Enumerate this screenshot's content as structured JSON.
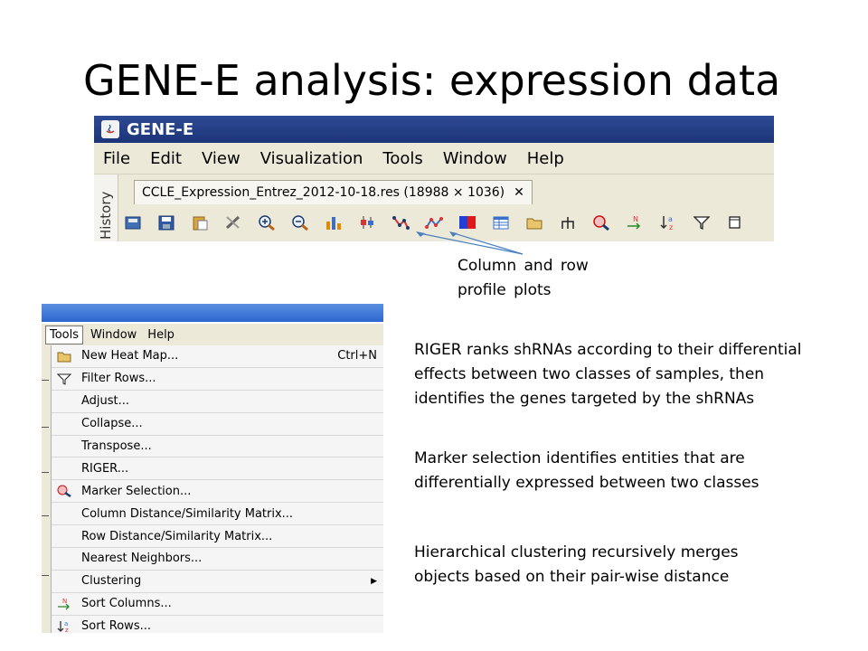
{
  "slide": {
    "title": "GENE-E analysis: expression data"
  },
  "app": {
    "title": "GENE-E",
    "menu": [
      "File",
      "Edit",
      "View",
      "Visualization",
      "Tools",
      "Window",
      "Help"
    ],
    "history_label": "History",
    "tab": {
      "label": "CCLE_Expression_Entrez_2012-10-18.res (18988 × 1036)",
      "close": "✕"
    },
    "toolbar_icons": [
      "open-icon",
      "save-icon",
      "paste-icon",
      "tools-icon",
      "zoom-in-icon",
      "zoom-out-icon",
      "bar-chart-icon",
      "box-plot-icon",
      "column-profile-plot-icon",
      "row-profile-plot-icon",
      "heatmap-color-icon",
      "table-icon",
      "folder-icon",
      "tree-icon",
      "marker-selection-icon",
      "sort-columns-icon",
      "sort-rows-icon",
      "filter-icon",
      "window-icon"
    ]
  },
  "annotation": {
    "line1": "Column and row",
    "line2": "profile plots"
  },
  "tools_menu": {
    "menubar": [
      "Tools",
      "Window",
      "Help"
    ],
    "items": [
      {
        "label": "New Heat Map...",
        "shortcut": "Ctrl+N",
        "icon": "folder-icon"
      },
      {
        "label": "Filter Rows...",
        "shortcut": "",
        "icon": "filter-icon"
      },
      {
        "label": "Adjust...",
        "shortcut": "",
        "icon": ""
      },
      {
        "label": "Collapse...",
        "shortcut": "",
        "icon": ""
      },
      {
        "label": "Transpose...",
        "shortcut": "",
        "icon": ""
      },
      {
        "label": "RIGER...",
        "shortcut": "",
        "icon": ""
      },
      {
        "label": "Marker Selection...",
        "shortcut": "",
        "icon": "marker-selection-icon"
      },
      {
        "label": "Column Distance/Similarity Matrix...",
        "shortcut": "",
        "icon": ""
      },
      {
        "label": "Row Distance/Similarity Matrix...",
        "shortcut": "",
        "icon": ""
      },
      {
        "label": "Nearest Neighbors...",
        "shortcut": "",
        "icon": ""
      },
      {
        "label": "Clustering",
        "shortcut": "",
        "icon": "",
        "submenu": true
      },
      {
        "label": "Sort Columns...",
        "shortcut": "",
        "icon": "sort-columns-icon"
      },
      {
        "label": "Sort Rows...",
        "shortcut": "",
        "icon": "sort-rows-icon"
      }
    ]
  },
  "descriptions": {
    "riger": [
      "RIGER ranks shRNAs according to their differential",
      "effects between two classes of samples, then",
      "identifies the genes targeted by the shRNAs"
    ],
    "marker": [
      "Marker selection identifies entities that are",
      "differentially expressed between two classes"
    ],
    "clustering": [
      "Hierarchical clustering recursively merges",
      "objects based on their pair-wise distance"
    ]
  },
  "colors": {
    "titlebar": "#1c3478",
    "menubar": "#ece9d8",
    "menu_bg": "#f5f5f5",
    "annotation_arrow": "#4a7fc1"
  }
}
